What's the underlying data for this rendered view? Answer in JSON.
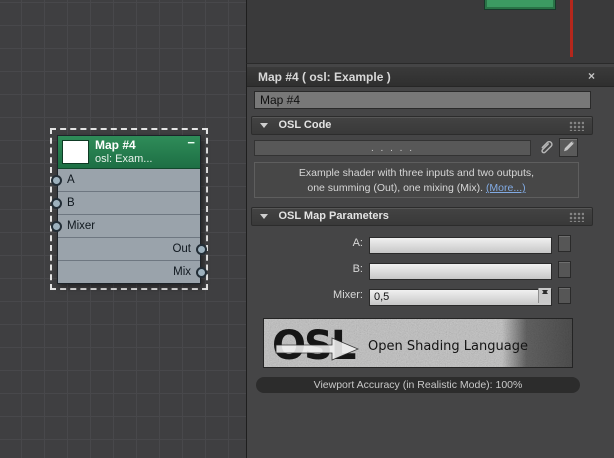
{
  "icons": {
    "collapse_minus": "−",
    "close": "×",
    "rollout_arrow": "triangle-down (css shape)",
    "grip": "dot-grid (css shape)",
    "spinner": "up-down triangles (css shape)",
    "paperclip": "paperclip (svg shape)",
    "pencil": "pencil (svg shape)"
  },
  "colors": {
    "node_header_green": "#22804e",
    "connection_wire_red": "#b5271c",
    "link_blue": "#82abe4"
  },
  "node_view": {
    "node": {
      "title": "Map #4",
      "subtitle": "osl: Exam...",
      "inputs": [
        {
          "label": "A"
        },
        {
          "label": "B"
        },
        {
          "label": "Mixer"
        }
      ],
      "outputs": [
        {
          "label": "Out"
        },
        {
          "label": "Mix"
        }
      ]
    }
  },
  "params_panel": {
    "title": "Map #4  ( osl: Example )",
    "name_field_value": "Map #4",
    "osl_code_rollout": {
      "label": "OSL Code",
      "code_field_value": ". . . . .",
      "description_line1": "Example shader with three inputs and two outputs,",
      "description_line2": "one summing (Out), one mixing (Mix).",
      "more_link": "(More...)"
    },
    "osl_params_rollout": {
      "label": "OSL Map Parameters",
      "params": [
        {
          "label": "A:",
          "value": ""
        },
        {
          "label": "B:",
          "value": ""
        },
        {
          "label": "Mixer:",
          "value": "0,5"
        }
      ]
    },
    "logo": {
      "wordmark": "OSL",
      "caption": "Open Shading Language"
    },
    "status_text": "Viewport Accuracy (in Realistic Mode): 100%"
  }
}
